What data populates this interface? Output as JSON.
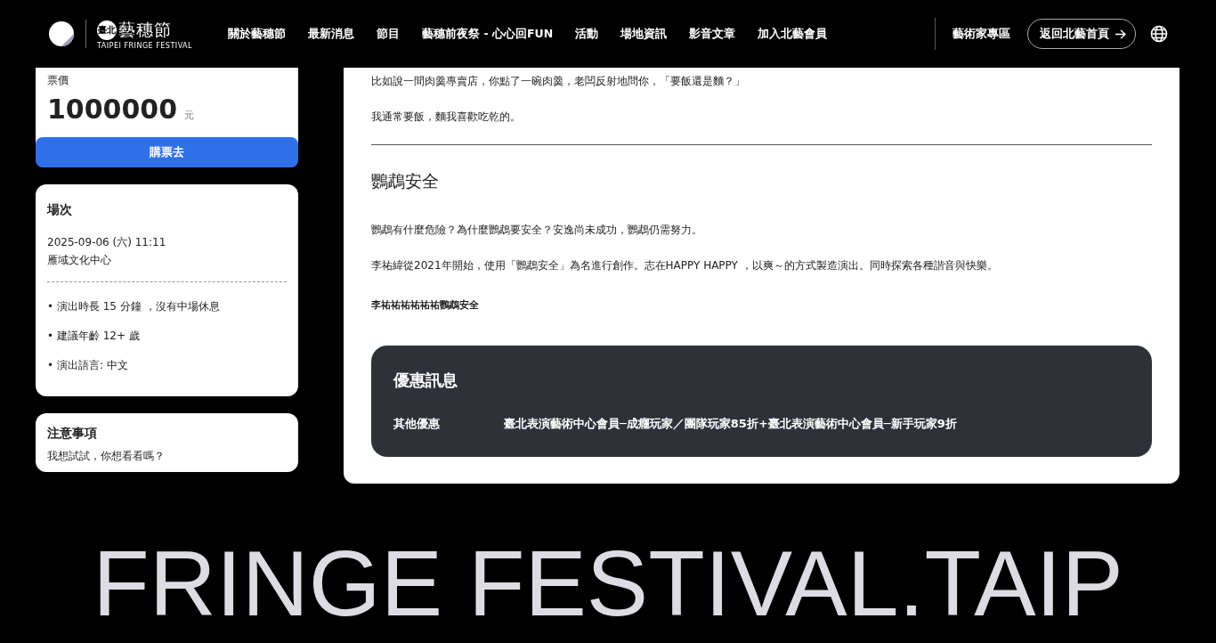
{
  "header": {
    "logo": {
      "badge": "臺北",
      "wordmark": "藝穗節",
      "subtitle": "TAIPEI FRINGE FESTIVAL"
    },
    "nav": [
      "關於藝穗節",
      "最新消息",
      "節目",
      "藝穗前夜祭 - 心心回FUN",
      "活動",
      "場地資訊",
      "影音文章",
      "加入北藝會員"
    ],
    "artist_zone": "藝術家專區",
    "home_button": "返回北藝首頁"
  },
  "ticket": {
    "label": "票價",
    "price": "1000000",
    "unit": "元",
    "buy_button": "購票去"
  },
  "session": {
    "title": "場次",
    "datetime": "2025-09-06 (六) 11:11",
    "venue": "雁域文化中心",
    "notes": [
      "• 演出時長 15 分鐘 ，沒有中場休息",
      "• 建議年齡 12+ 歲",
      "• 演出語言: 中文"
    ]
  },
  "notice": {
    "title": "注意事項",
    "text": "我想試試，你想看看嗎？"
  },
  "article": {
    "paragraphs": [
      "比如說一間肉羹專賣店，你點了一碗肉羹，老闆反射地問你，「要飯還是麵？」",
      "我通常要飯，麵我喜歡吃乾的。"
    ],
    "section_title": "鸚鵡安全",
    "section_items": [
      {
        "kind": "paragraph",
        "text": "鸚鵡有什麼危險？為什麼鸚鵡要安全？安逸尚未成功，鸚鵡仍需努力。"
      },
      {
        "kind": "paragraph",
        "text": "李祐緯從2021年開始，使用「鸚鵡安全」為名進行創作。志在HAPPY HAPPY ，以爽～的方式製造演出。同時探索各種諧音與快樂。"
      },
      {
        "kind": "caption",
        "text": "李祐祐祐祐祐祐鸚鵡安全"
      }
    ]
  },
  "discount": {
    "title": "優惠訊息",
    "rows": [
      {
        "label": "其他優惠",
        "value": "臺北表演藝術中心會員─成癮玩家／團隊玩家85折+臺北表演藝術中心會員─新手玩家9折"
      }
    ]
  },
  "footer_marquee": "FRINGE FESTIVAL.TAIP"
}
